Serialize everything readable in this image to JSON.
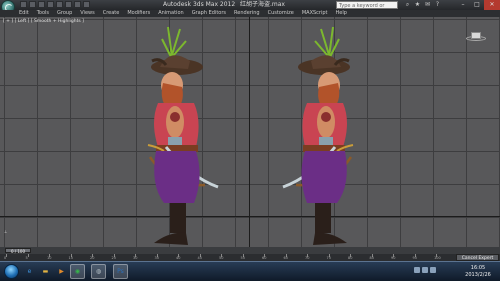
{
  "window": {
    "title": "Autodesk 3ds Max  2012",
    "file": "红胡子海盗.max",
    "search_placeholder": "Type a keyword or phrase",
    "buttons": {
      "minimize": "–",
      "maximize": "□",
      "close": "✕"
    }
  },
  "menu": [
    "Edit",
    "Tools",
    "Group",
    "Views",
    "Create",
    "Modifiers",
    "Animation",
    "Graph Editors",
    "Rendering",
    "Customize",
    "MAXScript",
    "Help"
  ],
  "viewport": {
    "label": "[ + ] [ Left ] [ Smooth + Highlights ]",
    "background": "#58585a",
    "grid_color": "#3d3d3f"
  },
  "timeline": {
    "frame_display": "0 / 100",
    "ticks": [
      "0",
      "5",
      "10",
      "15",
      "20",
      "25",
      "30",
      "35",
      "40",
      "45",
      "50",
      "55",
      "60",
      "65",
      "70",
      "75",
      "80",
      "85",
      "90",
      "95",
      "100"
    ],
    "expert_button": "Cancel Expert Mode"
  },
  "taskbar": {
    "apps": [
      {
        "name": "ie-icon",
        "glyph": "e",
        "color": "#3b8fd8"
      },
      {
        "name": "folder-icon",
        "glyph": "▬",
        "color": "#e2b343"
      },
      {
        "name": "media-icon",
        "glyph": "▶",
        "color": "#e08a2c"
      },
      {
        "name": "browser-icon",
        "glyph": "◉",
        "color": "#36b34a"
      },
      {
        "name": "3dsmax-icon",
        "glyph": "◍",
        "color": "#b8c2c8"
      },
      {
        "name": "photoshop-icon",
        "glyph": "Ps",
        "color": "#2b6fb8"
      }
    ],
    "clock_time": "16:05",
    "clock_date": "2013/2/26"
  },
  "colors": {
    "shirt": "#c94452",
    "pants": "#6b2e86",
    "beard": "#b2532a",
    "hat": "#4a3425",
    "boots": "#2a1f1a",
    "saber": "#c8d3d8",
    "plant": "#7cb82e"
  }
}
